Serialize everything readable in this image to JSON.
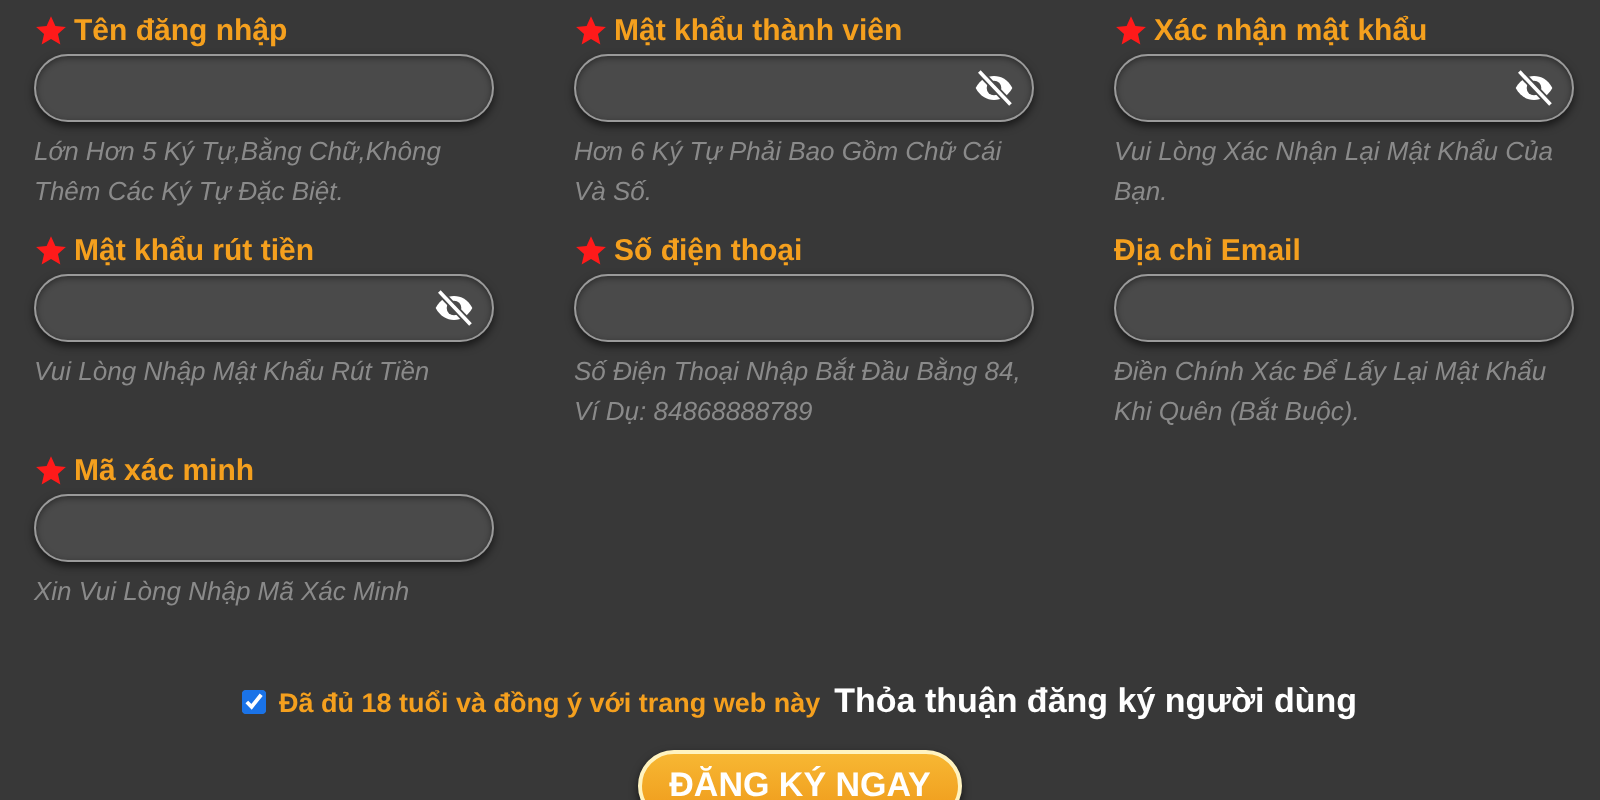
{
  "fields": [
    {
      "label": "Tên đăng nhập",
      "required": true,
      "kind": "text",
      "hint": "Lớn Hơn 5 Ký Tự,Bằng Chữ,Không Thêm Các Ký Tự Đặc Biệt."
    },
    {
      "label": "Mật khẩu thành viên",
      "required": true,
      "kind": "password",
      "hint": "Hơn 6 Ký Tự Phải Bao Gồm Chữ Cái Và Số."
    },
    {
      "label": "Xác nhận mật khẩu",
      "required": true,
      "kind": "password",
      "hint": "Vui Lòng Xác Nhận Lại Mật Khẩu Của Bạn."
    },
    {
      "label": "Mật khẩu rút tiền",
      "required": true,
      "kind": "password",
      "hint": "Vui Lòng Nhập Mật Khẩu Rút Tiền"
    },
    {
      "label": "Số điện thoại",
      "required": true,
      "kind": "text",
      "hint": "Số Điện Thoại Nhập Bắt Đầu Bằng 84, Ví Dụ: 84868888789"
    },
    {
      "label": "Địa chỉ Email",
      "required": false,
      "kind": "text",
      "hint": "Điền Chính Xác Để Lấy Lại Mật Khẩu Khi Quên (Bắt Buộc)."
    },
    {
      "label": "Mã xác minh",
      "required": true,
      "kind": "text",
      "hint": "Xin Vui Lòng Nhập Mã Xác Minh"
    }
  ],
  "agreement": {
    "checked": true,
    "text": "Đã đủ 18 tuổi và đồng ý với trang web này",
    "link": "Thỏa thuận đăng ký người dùng"
  },
  "submit": "ĐĂNG KÝ NGAY"
}
